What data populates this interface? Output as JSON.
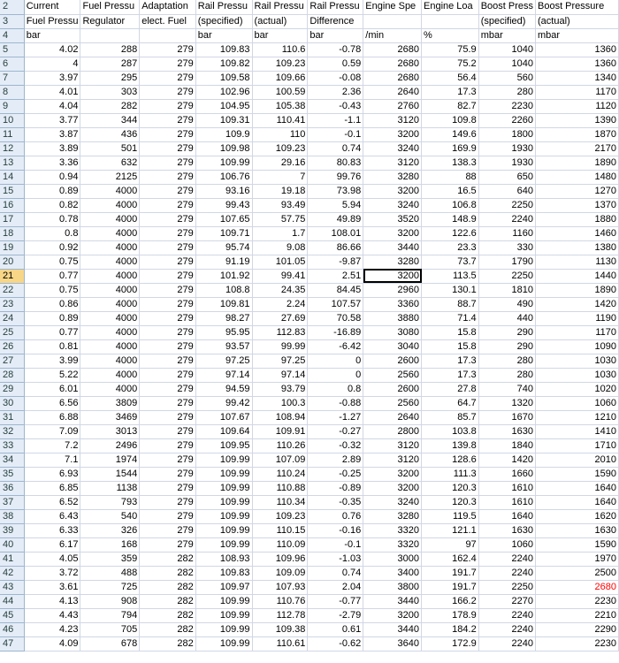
{
  "header_rows": [
    {
      "row": "2",
      "cells": [
        "Current",
        "Fuel Pressu",
        "Adaptation",
        "Rail Pressu",
        "Rail Pressu",
        "Rail Pressu",
        "Engine Spe",
        "Engine Loa",
        "Boost Press",
        "Boost Pressure"
      ]
    },
    {
      "row": "3",
      "cells": [
        "Fuel Pressu",
        "Regulator",
        "elect. Fuel",
        "(specified)",
        "(actual)",
        "Difference",
        "",
        "",
        "(specified)",
        "(actual)"
      ]
    },
    {
      "row": "4",
      "cells": [
        "bar",
        "",
        "",
        "bar",
        "bar",
        "bar",
        "/min",
        "%",
        "mbar",
        "mbar"
      ]
    }
  ],
  "data_rows": [
    {
      "row": "5",
      "cells": [
        "4.02",
        "288",
        "279",
        "109.83",
        "110.6",
        "-0.78",
        "2680",
        "75.9",
        "1040",
        "1360"
      ]
    },
    {
      "row": "6",
      "cells": [
        "4",
        "287",
        "279",
        "109.82",
        "109.23",
        "0.59",
        "2680",
        "75.2",
        "1040",
        "1360"
      ]
    },
    {
      "row": "7",
      "cells": [
        "3.97",
        "295",
        "279",
        "109.58",
        "109.66",
        "-0.08",
        "2680",
        "56.4",
        "560",
        "1340"
      ]
    },
    {
      "row": "8",
      "cells": [
        "4.01",
        "303",
        "279",
        "102.96",
        "100.59",
        "2.36",
        "2640",
        "17.3",
        "280",
        "1170"
      ]
    },
    {
      "row": "9",
      "cells": [
        "4.04",
        "282",
        "279",
        "104.95",
        "105.38",
        "-0.43",
        "2760",
        "82.7",
        "2230",
        "1120"
      ]
    },
    {
      "row": "10",
      "cells": [
        "3.77",
        "344",
        "279",
        "109.31",
        "110.41",
        "-1.1",
        "3120",
        "109.8",
        "2260",
        "1390"
      ]
    },
    {
      "row": "11",
      "cells": [
        "3.87",
        "436",
        "279",
        "109.9",
        "110",
        "-0.1",
        "3200",
        "149.6",
        "1800",
        "1870"
      ]
    },
    {
      "row": "12",
      "cells": [
        "3.89",
        "501",
        "279",
        "109.98",
        "109.23",
        "0.74",
        "3240",
        "169.9",
        "1930",
        "2170"
      ]
    },
    {
      "row": "13",
      "cells": [
        "3.36",
        "632",
        "279",
        "109.99",
        "29.16",
        "80.83",
        "3120",
        "138.3",
        "1930",
        "1890"
      ]
    },
    {
      "row": "14",
      "cells": [
        "0.94",
        "2125",
        "279",
        "106.76",
        "7",
        "99.76",
        "3280",
        "88",
        "650",
        "1480"
      ]
    },
    {
      "row": "15",
      "cells": [
        "0.89",
        "4000",
        "279",
        "93.16",
        "19.18",
        "73.98",
        "3200",
        "16.5",
        "640",
        "1270"
      ]
    },
    {
      "row": "16",
      "cells": [
        "0.82",
        "4000",
        "279",
        "99.43",
        "93.49",
        "5.94",
        "3240",
        "106.8",
        "2250",
        "1370"
      ]
    },
    {
      "row": "17",
      "cells": [
        "0.78",
        "4000",
        "279",
        "107.65",
        "57.75",
        "49.89",
        "3520",
        "148.9",
        "2240",
        "1880"
      ]
    },
    {
      "row": "18",
      "cells": [
        "0.8",
        "4000",
        "279",
        "109.71",
        "1.7",
        "108.01",
        "3200",
        "122.6",
        "1160",
        "1460"
      ]
    },
    {
      "row": "19",
      "cells": [
        "0.92",
        "4000",
        "279",
        "95.74",
        "9.08",
        "86.66",
        "3440",
        "23.3",
        "330",
        "1380"
      ]
    },
    {
      "row": "20",
      "cells": [
        "0.75",
        "4000",
        "279",
        "91.19",
        "101.05",
        "-9.87",
        "3280",
        "73.7",
        "1790",
        "1130"
      ]
    },
    {
      "row": "21",
      "cells": [
        "0.77",
        "4000",
        "279",
        "101.92",
        "99.41",
        "2.51",
        "3200",
        "113.5",
        "2250",
        "1440"
      ]
    },
    {
      "row": "22",
      "cells": [
        "0.75",
        "4000",
        "279",
        "108.8",
        "24.35",
        "84.45",
        "2960",
        "130.1",
        "1810",
        "1890"
      ]
    },
    {
      "row": "23",
      "cells": [
        "0.86",
        "4000",
        "279",
        "109.81",
        "2.24",
        "107.57",
        "3360",
        "88.7",
        "490",
        "1420"
      ]
    },
    {
      "row": "24",
      "cells": [
        "0.89",
        "4000",
        "279",
        "98.27",
        "27.69",
        "70.58",
        "3880",
        "71.4",
        "440",
        "1190"
      ]
    },
    {
      "row": "25",
      "cells": [
        "0.77",
        "4000",
        "279",
        "95.95",
        "112.83",
        "-16.89",
        "3080",
        "15.8",
        "290",
        "1170"
      ]
    },
    {
      "row": "26",
      "cells": [
        "0.81",
        "4000",
        "279",
        "93.57",
        "99.99",
        "-6.42",
        "3040",
        "15.8",
        "290",
        "1090"
      ]
    },
    {
      "row": "27",
      "cells": [
        "3.99",
        "4000",
        "279",
        "97.25",
        "97.25",
        "0",
        "2600",
        "17.3",
        "280",
        "1030"
      ]
    },
    {
      "row": "28",
      "cells": [
        "5.22",
        "4000",
        "279",
        "97.14",
        "97.14",
        "0",
        "2560",
        "17.3",
        "280",
        "1030"
      ]
    },
    {
      "row": "29",
      "cells": [
        "6.01",
        "4000",
        "279",
        "94.59",
        "93.79",
        "0.8",
        "2600",
        "27.8",
        "740",
        "1020"
      ]
    },
    {
      "row": "30",
      "cells": [
        "6.56",
        "3809",
        "279",
        "99.42",
        "100.3",
        "-0.88",
        "2560",
        "64.7",
        "1320",
        "1060"
      ]
    },
    {
      "row": "31",
      "cells": [
        "6.88",
        "3469",
        "279",
        "107.67",
        "108.94",
        "-1.27",
        "2640",
        "85.7",
        "1670",
        "1210"
      ]
    },
    {
      "row": "32",
      "cells": [
        "7.09",
        "3013",
        "279",
        "109.64",
        "109.91",
        "-0.27",
        "2800",
        "103.8",
        "1630",
        "1410"
      ]
    },
    {
      "row": "33",
      "cells": [
        "7.2",
        "2496",
        "279",
        "109.95",
        "110.26",
        "-0.32",
        "3120",
        "139.8",
        "1840",
        "1710"
      ]
    },
    {
      "row": "34",
      "cells": [
        "7.1",
        "1974",
        "279",
        "109.99",
        "107.09",
        "2.89",
        "3120",
        "128.6",
        "1420",
        "2010"
      ]
    },
    {
      "row": "35",
      "cells": [
        "6.93",
        "1544",
        "279",
        "109.99",
        "110.24",
        "-0.25",
        "3200",
        "111.3",
        "1660",
        "1590"
      ]
    },
    {
      "row": "36",
      "cells": [
        "6.85",
        "1138",
        "279",
        "109.99",
        "110.88",
        "-0.89",
        "3200",
        "120.3",
        "1610",
        "1640"
      ]
    },
    {
      "row": "37",
      "cells": [
        "6.52",
        "793",
        "279",
        "109.99",
        "110.34",
        "-0.35",
        "3240",
        "120.3",
        "1610",
        "1640"
      ]
    },
    {
      "row": "38",
      "cells": [
        "6.43",
        "540",
        "279",
        "109.99",
        "109.23",
        "0.76",
        "3280",
        "119.5",
        "1640",
        "1620"
      ]
    },
    {
      "row": "39",
      "cells": [
        "6.33",
        "326",
        "279",
        "109.99",
        "110.15",
        "-0.16",
        "3320",
        "121.1",
        "1630",
        "1630"
      ]
    },
    {
      "row": "40",
      "cells": [
        "6.17",
        "168",
        "279",
        "109.99",
        "110.09",
        "-0.1",
        "3320",
        "97",
        "1060",
        "1590"
      ]
    },
    {
      "row": "41",
      "cells": [
        "4.05",
        "359",
        "282",
        "108.93",
        "109.96",
        "-1.03",
        "3000",
        "162.4",
        "2240",
        "1970"
      ]
    },
    {
      "row": "42",
      "cells": [
        "3.72",
        "488",
        "282",
        "109.83",
        "109.09",
        "0.74",
        "3400",
        "191.7",
        "2240",
        "2500"
      ]
    },
    {
      "row": "43",
      "cells": [
        "3.61",
        "725",
        "282",
        "109.97",
        "107.93",
        "2.04",
        "3800",
        "191.7",
        "2250",
        "2680"
      ]
    },
    {
      "row": "44",
      "cells": [
        "4.13",
        "908",
        "282",
        "109.99",
        "110.76",
        "-0.77",
        "3440",
        "166.2",
        "2270",
        "2230"
      ]
    },
    {
      "row": "45",
      "cells": [
        "4.43",
        "794",
        "282",
        "109.99",
        "112.78",
        "-2.79",
        "3200",
        "178.9",
        "2240",
        "2210"
      ]
    },
    {
      "row": "46",
      "cells": [
        "4.23",
        "705",
        "282",
        "109.99",
        "109.38",
        "0.61",
        "3440",
        "184.2",
        "2240",
        "2290"
      ]
    },
    {
      "row": "47",
      "cells": [
        "4.09",
        "678",
        "282",
        "109.99",
        "110.61",
        "-0.62",
        "3640",
        "172.9",
        "2240",
        "2230"
      ]
    }
  ],
  "active_row": "21",
  "selected_cell": {
    "row": "21",
    "col": 6
  },
  "highlight_cell": {
    "row": "43",
    "col": 9,
    "color": "#ff0000"
  },
  "colors": {
    "row_header_bg": "#e4ecf7",
    "active_row_header_bg": "#f8d687",
    "gridline": "#d0d7e5"
  }
}
